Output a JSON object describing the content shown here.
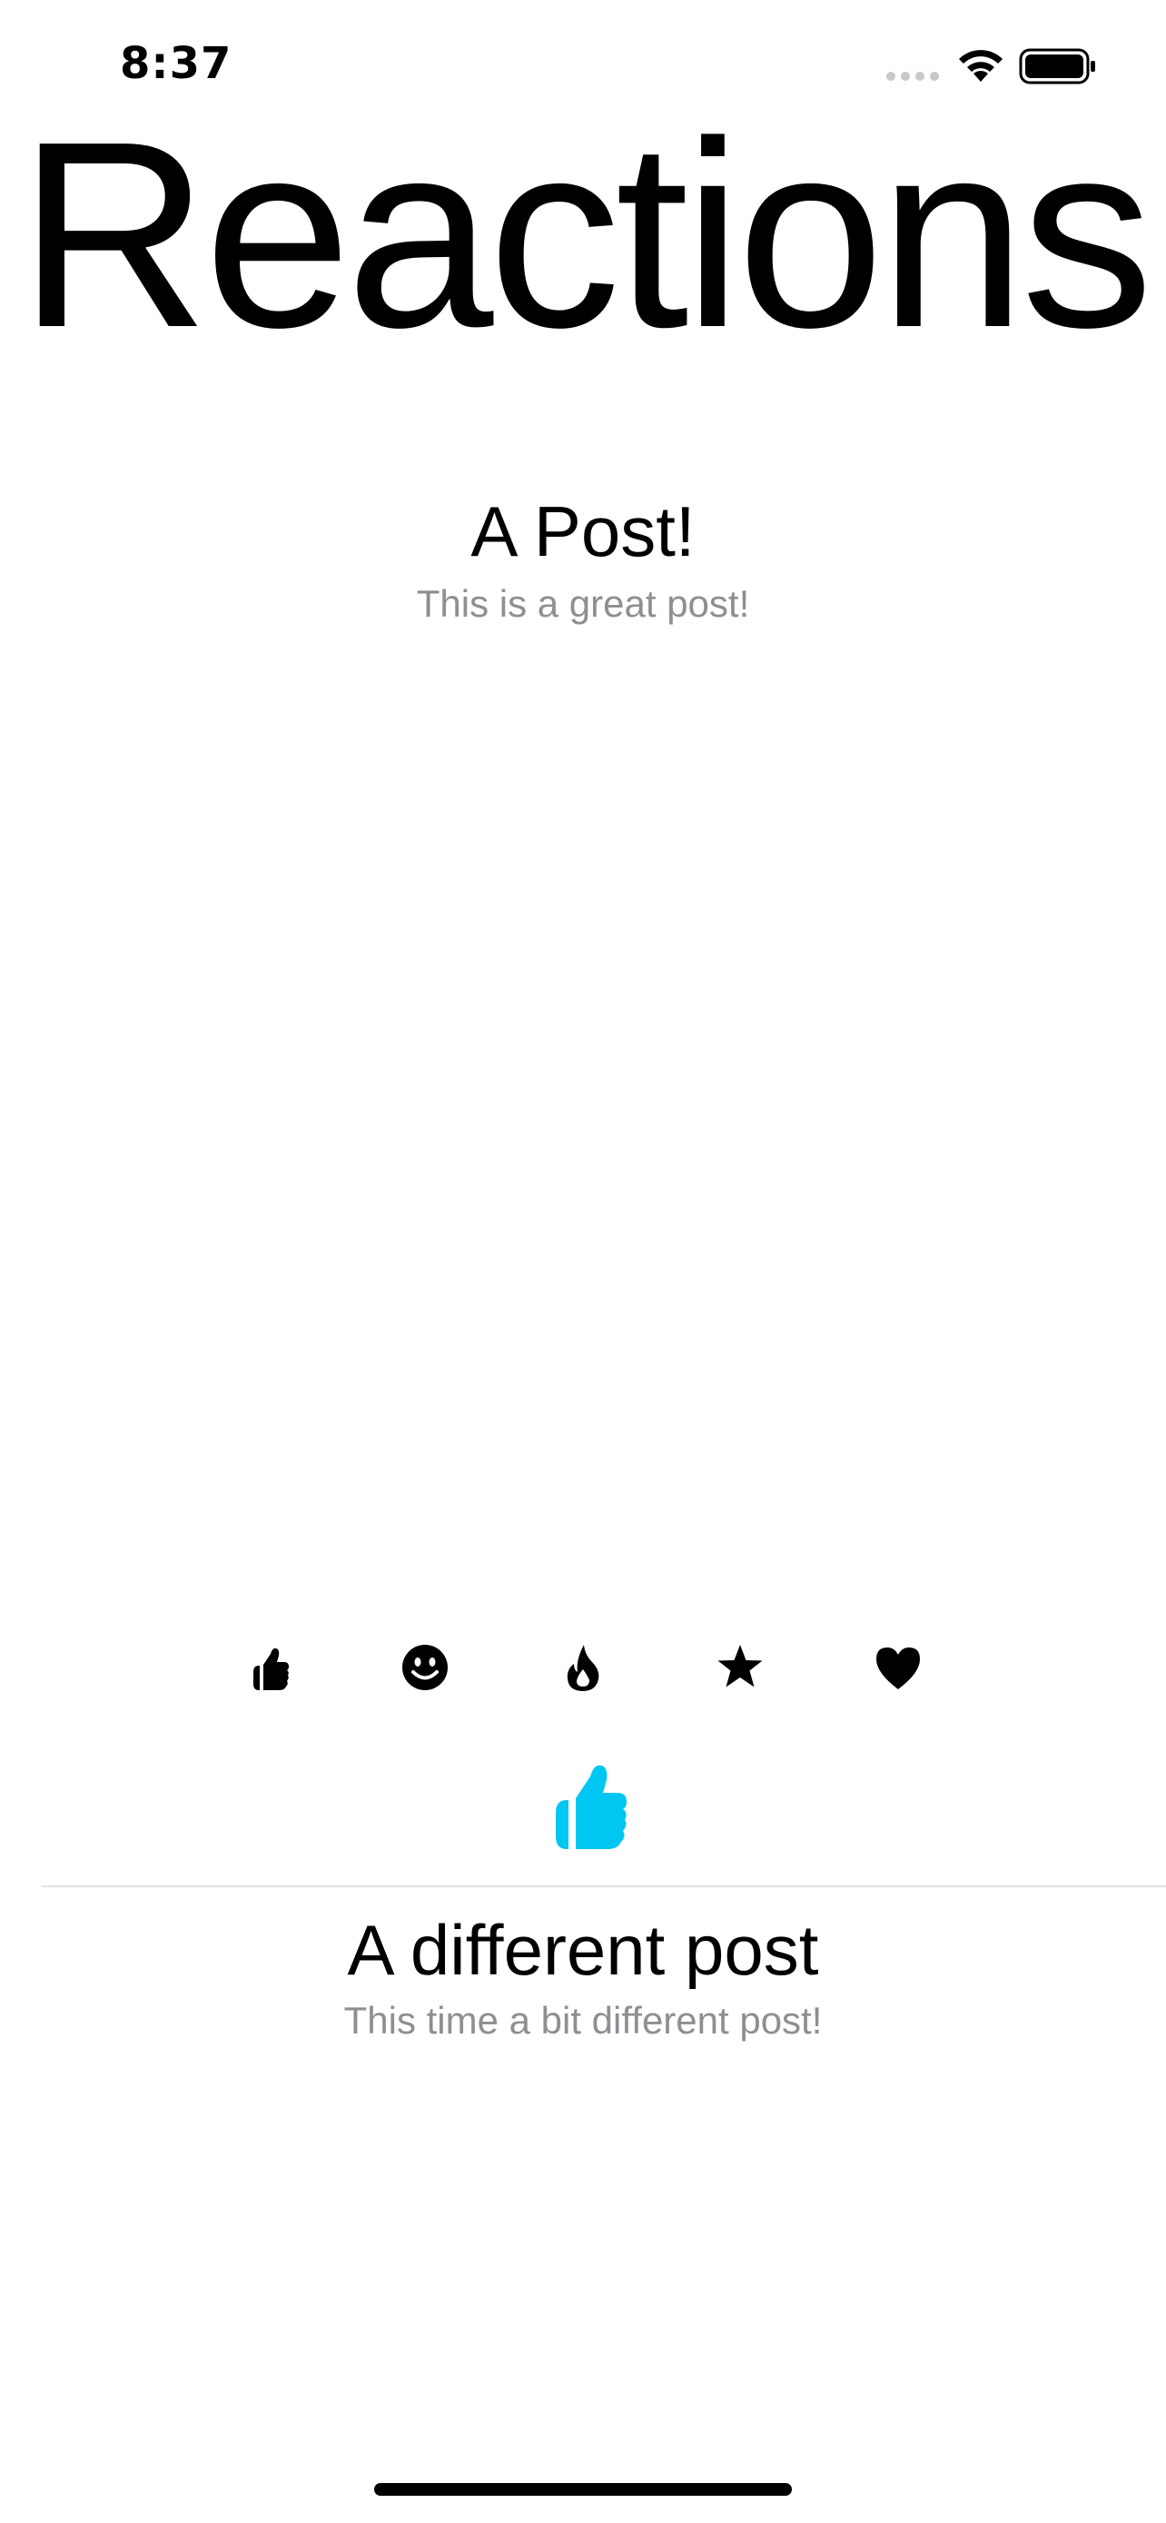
{
  "status_bar": {
    "time": "8:37",
    "icons": [
      "signal-icon",
      "wifi-icon",
      "battery-icon"
    ]
  },
  "page": {
    "title": "Reactions"
  },
  "posts": [
    {
      "title": "A Post!",
      "subtitle": "This is a great post!"
    },
    {
      "title": "A different post",
      "subtitle": "This time a bit different post!"
    }
  ],
  "reactions": {
    "options": [
      "thumbs-up-icon",
      "smile-icon",
      "fire-icon",
      "star-icon",
      "heart-icon"
    ],
    "selected": "thumbs-up-icon",
    "selected_color": "#00c7f2"
  }
}
